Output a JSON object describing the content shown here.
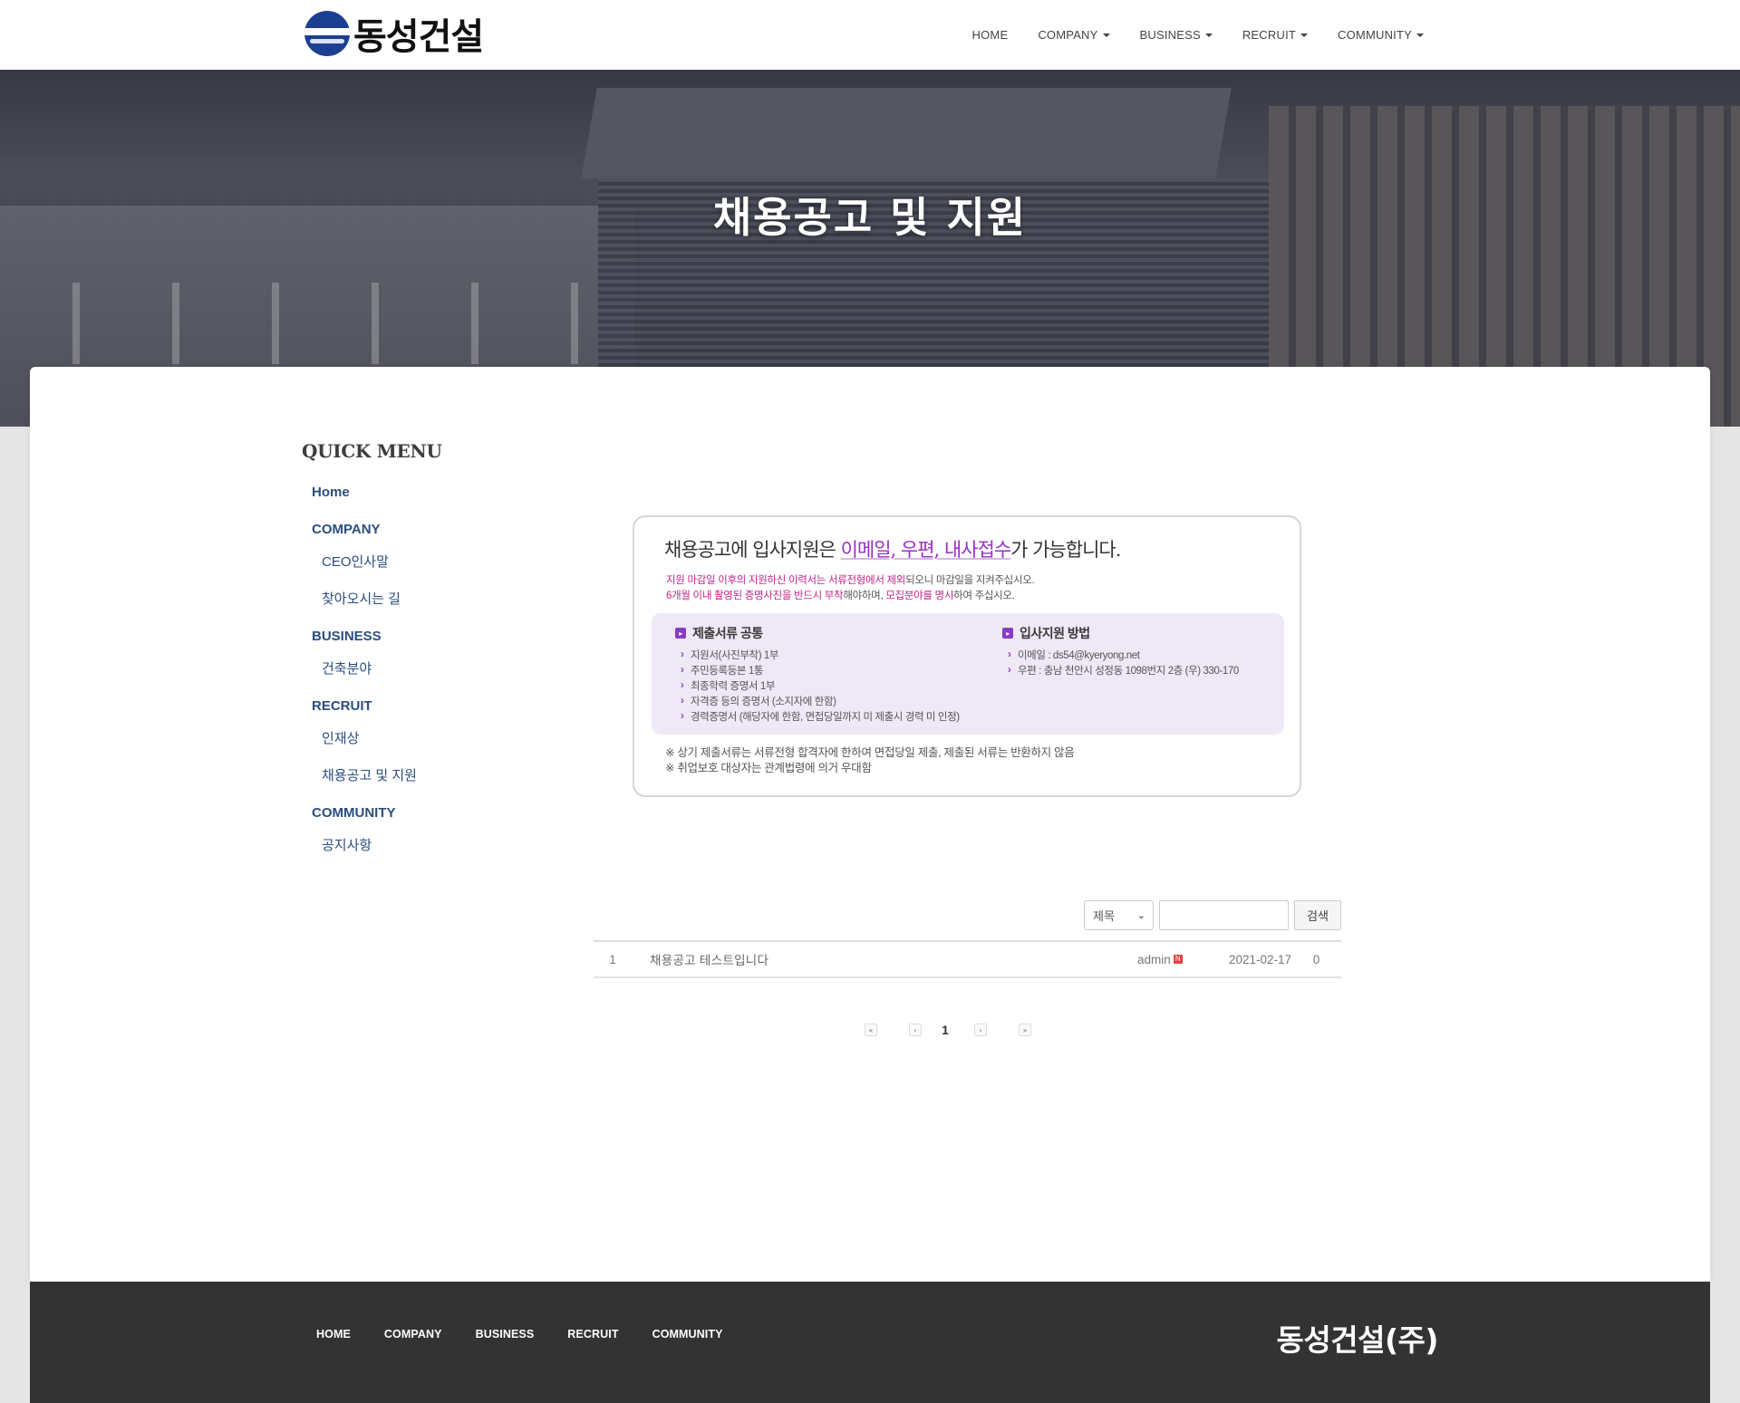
{
  "header": {
    "logo_text": "동성건설",
    "nav": [
      {
        "label": "HOME",
        "dropdown": false
      },
      {
        "label": "COMPANY",
        "dropdown": true
      },
      {
        "label": "BUSINESS",
        "dropdown": true
      },
      {
        "label": "RECRUIT",
        "dropdown": true
      },
      {
        "label": "COMMUNITY",
        "dropdown": true
      }
    ]
  },
  "hero": {
    "title": "채용공고 및 지원"
  },
  "sidebar": {
    "title": "QUICK MENU",
    "home": "Home",
    "sections": [
      {
        "label": "COMPANY",
        "items": [
          "CEO인사말",
          "찾아오시는 길"
        ]
      },
      {
        "label": "BUSINESS",
        "items": [
          "건축분야"
        ]
      },
      {
        "label": "RECRUIT",
        "items": [
          "인재상",
          "채용공고 및 지원"
        ]
      },
      {
        "label": "COMMUNITY",
        "items": [
          "공지사항"
        ]
      }
    ]
  },
  "notice": {
    "head_pre": "채용공고에 입사지원은 ",
    "head_hl": "이메일, 우편, 내사접수",
    "head_post": "가 가능합니다.",
    "line1_hl": "지원 마감일 이후의 지원하신 이력서는 서류전형에서 제외",
    "line1_post": "되오니 마감일을 지켜주십시오.",
    "line2_hl1": "6개월 이내 촬영된 증명사진을 반드시 부착",
    "line2_mid": "해야하며, ",
    "line2_hl2": "모집분야를 명시",
    "line2_post": "하여 주십시오.",
    "docs_title": "제출서류 공통",
    "docs": [
      "지원서(사진부착) 1부",
      "주민등록등본 1통",
      "최종학력 증명서 1부",
      "자격증 등의 증명서 (소지자에 한함)",
      "경력증명서 (해당자에 한함, 면접당일까지 미 제출시 경력 미 인정)"
    ],
    "apply_title": "입사지원 방법",
    "apply": [
      "이메일 : ds54@kyeryong.net",
      "우편 : 충남 천안시 성정동 1098번지 2층 (우) 330-170"
    ],
    "foot": [
      "※ 상기 제출서류는 서류전형 합격자에 한하여 면접당일 제출, 제출된 서류는 반환하지 않음",
      "※ 취업보호 대상자는 관계법령에 의거 우대함"
    ]
  },
  "search": {
    "select_value": "제목",
    "input_value": "",
    "button_label": "검색"
  },
  "board": {
    "rows": [
      {
        "num": "1",
        "title": "채용공고 테스트입니다",
        "author": "admin",
        "new_badge": "N",
        "date": "2021-02-17",
        "views": "0"
      }
    ]
  },
  "pagination": {
    "first": "«",
    "prev": "‹",
    "current": "1",
    "next": "›",
    "last": "»"
  },
  "footer": {
    "nav": [
      "HOME",
      "COMPANY",
      "BUSINESS",
      "RECRUIT",
      "COMMUNITY"
    ],
    "brand": "동성건설(주)"
  },
  "colors": {
    "nav_link": "#2b4d7e",
    "accent_purple": "#9a2fc4",
    "footer_bg": "#333333",
    "logo_blue": "#1b3f91"
  }
}
